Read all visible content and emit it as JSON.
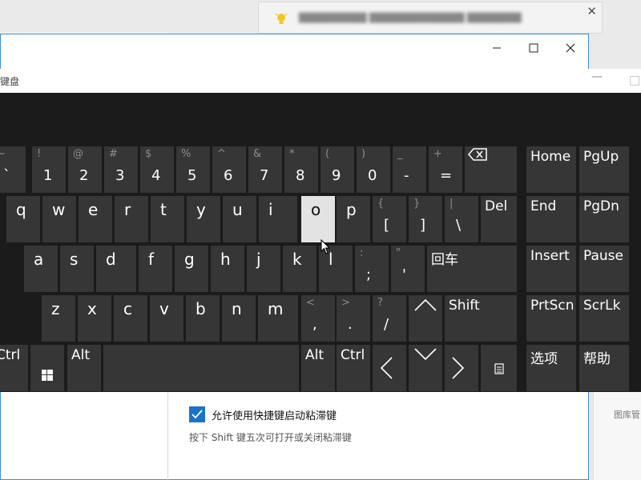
{
  "toast": {
    "text": "██████████ ██████████████ ████████"
  },
  "settings": {
    "sticky_keys_label": "允许使用快捷键启动粘滞键",
    "sticky_keys_desc": "按下 Shift 键五次可打开或关闭粘滞键",
    "right_pane_text": "图库管"
  },
  "osk": {
    "title": "键盘"
  },
  "keys": [
    {
      "id": "backtick",
      "main": "`",
      "shift": "~"
    },
    {
      "id": "1",
      "main": "1",
      "shift": "!"
    },
    {
      "id": "2",
      "main": "2",
      "shift": "@"
    },
    {
      "id": "3",
      "main": "3",
      "shift": "#"
    },
    {
      "id": "4",
      "main": "4",
      "shift": "$"
    },
    {
      "id": "5",
      "main": "5",
      "shift": "%"
    },
    {
      "id": "6",
      "main": "6",
      "shift": "^"
    },
    {
      "id": "7",
      "main": "7",
      "shift": "&"
    },
    {
      "id": "8",
      "main": "8",
      "shift": "*"
    },
    {
      "id": "9",
      "main": "9",
      "shift": "("
    },
    {
      "id": "0",
      "main": "0",
      "shift": ")"
    },
    {
      "id": "minus",
      "main": "-",
      "shift": "_"
    },
    {
      "id": "equals",
      "main": "=",
      "shift": "+"
    },
    {
      "id": "backspace",
      "icon": "backspace-icon"
    },
    {
      "id": "home",
      "label": "Home"
    },
    {
      "id": "pgup",
      "label": "PgUp"
    },
    {
      "id": "q",
      "main": "q"
    },
    {
      "id": "w",
      "main": "w"
    },
    {
      "id": "e",
      "main": "e"
    },
    {
      "id": "r",
      "main": "r"
    },
    {
      "id": "t",
      "main": "t"
    },
    {
      "id": "y",
      "main": "y"
    },
    {
      "id": "u",
      "main": "u"
    },
    {
      "id": "i",
      "main": "i"
    },
    {
      "id": "o",
      "main": "o",
      "pressed": true
    },
    {
      "id": "p",
      "main": "p"
    },
    {
      "id": "lbracket",
      "main": "[",
      "shift": "{"
    },
    {
      "id": "rbracket",
      "main": "]",
      "shift": "}"
    },
    {
      "id": "backslash",
      "main": "\\",
      "shift": "|"
    },
    {
      "id": "del",
      "label": "Del"
    },
    {
      "id": "end",
      "label": "End"
    },
    {
      "id": "pgdn",
      "label": "PgDn"
    },
    {
      "id": "a",
      "main": "a"
    },
    {
      "id": "s",
      "main": "s"
    },
    {
      "id": "d",
      "main": "d"
    },
    {
      "id": "f",
      "main": "f"
    },
    {
      "id": "g",
      "main": "g"
    },
    {
      "id": "h",
      "main": "h"
    },
    {
      "id": "j",
      "main": "j"
    },
    {
      "id": "k",
      "main": "k"
    },
    {
      "id": "l",
      "main": "l"
    },
    {
      "id": "semicolon",
      "main": ";",
      "shift": ":"
    },
    {
      "id": "quote",
      "main": "'",
      "shift": "\""
    },
    {
      "id": "enter",
      "label": "回车"
    },
    {
      "id": "insert",
      "label": "Insert"
    },
    {
      "id": "pause",
      "label": "Pause"
    },
    {
      "id": "z",
      "main": "z"
    },
    {
      "id": "x",
      "main": "x"
    },
    {
      "id": "c",
      "main": "c"
    },
    {
      "id": "v",
      "main": "v"
    },
    {
      "id": "b",
      "main": "b"
    },
    {
      "id": "n",
      "main": "n"
    },
    {
      "id": "m",
      "main": "m"
    },
    {
      "id": "comma",
      "main": ",",
      "shift": "<"
    },
    {
      "id": "period",
      "main": ".",
      "shift": ">"
    },
    {
      "id": "slash",
      "main": "/",
      "shift": "?"
    },
    {
      "id": "up",
      "icon": "arrow-up-icon"
    },
    {
      "id": "rshift",
      "label": "Shift"
    },
    {
      "id": "prtscn",
      "label": "PrtScn"
    },
    {
      "id": "scrlk",
      "label": "ScrLk"
    },
    {
      "id": "lctrl",
      "label": "Ctrl"
    },
    {
      "id": "win",
      "icon": "windows-icon"
    },
    {
      "id": "lalt",
      "label": "Alt"
    },
    {
      "id": "space",
      "label": ""
    },
    {
      "id": "ralt",
      "label": "Alt"
    },
    {
      "id": "rctrl",
      "label": "Ctrl"
    },
    {
      "id": "left",
      "icon": "arrow-left-icon"
    },
    {
      "id": "down",
      "icon": "arrow-down-icon"
    },
    {
      "id": "right",
      "icon": "arrow-right-icon"
    },
    {
      "id": "menu",
      "icon": "menu-key-icon"
    },
    {
      "id": "options",
      "label": "选项"
    },
    {
      "id": "help",
      "label": "帮助"
    }
  ]
}
